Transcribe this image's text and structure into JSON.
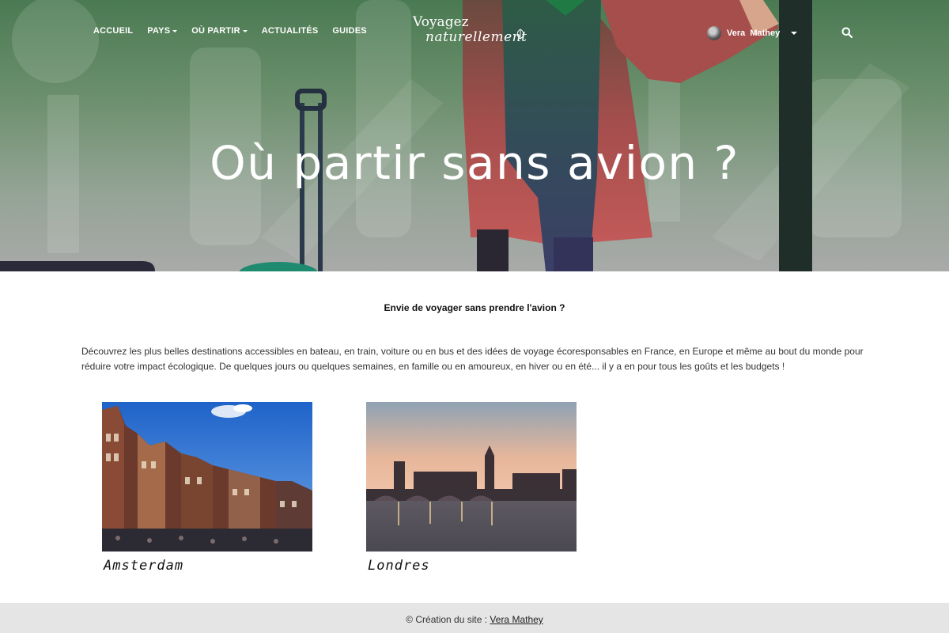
{
  "nav": {
    "items": [
      {
        "label": "ACCUEIL",
        "dropdown": false
      },
      {
        "label": "PAYS",
        "dropdown": true
      },
      {
        "label": "OÙ PARTIR",
        "dropdown": true
      },
      {
        "label": "ACTUALITÉS",
        "dropdown": false
      },
      {
        "label": "GUIDES",
        "dropdown": false
      }
    ]
  },
  "logo": {
    "line1": "Voyagez",
    "line2": "naturellement"
  },
  "user": {
    "name": "Vera  Mathey",
    "icon": "avatar"
  },
  "search": {
    "icon": "search-icon"
  },
  "hero": {
    "title": "Où partir sans avion ?"
  },
  "intro": {
    "title": "Envie de voyager sans prendre l'avion ?",
    "text": "Découvrez les plus belles destinations accessibles en bateau, en train, voiture ou en bus et des idées de voyage écoresponsables en France, en Europe et même au bout du monde pour réduire votre impact écologique. De quelques jours ou quelques semaines, en famille ou en amoureux, en hiver ou en été... il y a en pour tous les goûts et les budgets !"
  },
  "cards": [
    {
      "label": "Amsterdam"
    },
    {
      "label": "Londres"
    }
  ],
  "footer": {
    "prefix": "© Création du site : ",
    "link": "Vera Mathey"
  },
  "colors": {
    "hero_green": "#4a7a52",
    "coat_red": "#b0504f",
    "footer_bg": "#e5e5e5"
  }
}
